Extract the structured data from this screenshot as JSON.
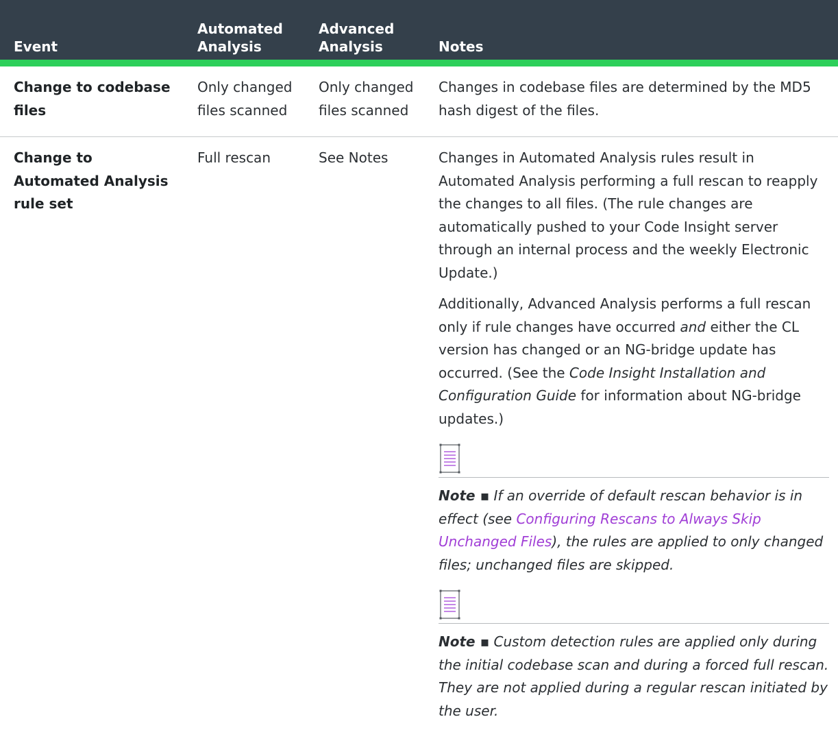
{
  "header": {
    "event": "Event",
    "automated": "Automated Analysis",
    "advanced": "Advanced Analysis",
    "notes": "Notes"
  },
  "rows": [
    {
      "event": "Change to codebase files",
      "automated": "Only changed files scanned",
      "advanced": "Only changed files scanned",
      "notes": "Changes in codebase files are determined by the MD5 hash digest of the files."
    },
    {
      "event": "Change to Automated Analysis rule set",
      "automated": "Full rescan",
      "advanced": "See Notes",
      "notes_p1": "Changes in Automated Analysis rules result in Automated Analysis performing a full rescan to reapply the changes to all files. (The rule changes are automatically pushed to your Code Insight server through an internal process and the weekly Electronic Update.)",
      "notes_p2": {
        "a": "Additionally, Advanced Analysis performs a full rescan only if rule changes have occurred ",
        "and": "and",
        "b": " either the CL version has changed or an NG-bridge update has occurred. (See the ",
        "guide": "Code Insight Installation and Configuration Guide",
        "c": " for information about NG-bridge updates.)"
      },
      "note1": {
        "label": "Note ▪",
        "a": " If an override of default rescan behavior is in effect (see ",
        "link": "Configuring Rescans to Always Skip Unchanged Files",
        "b": "), the rules are applied to only changed files; unchanged files are skipped."
      },
      "note2": {
        "label": "Note ▪",
        "text": " Custom detection rules are applied only during the initial codebase scan and during a forced full rescan. They are not applied during a regular rescan initiated by the user."
      }
    }
  ],
  "colors": {
    "header_bg": "#34404b",
    "header_accent": "#2dcf5a",
    "link": "#a03ed6"
  },
  "icons": [
    "note-icon"
  ]
}
